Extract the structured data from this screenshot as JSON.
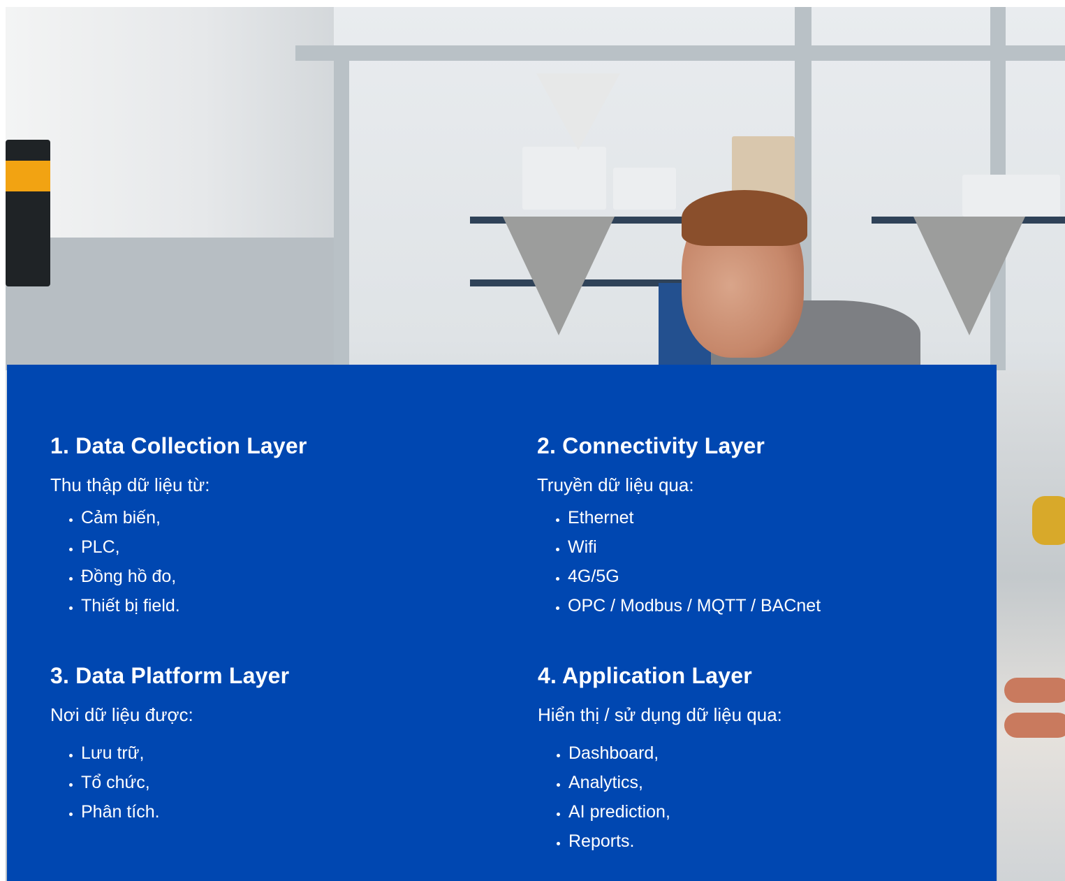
{
  "sections": [
    {
      "title": "1. Data Collection Layer",
      "intro": "Thu thập dữ liệu từ:",
      "items": [
        "Cảm biến,",
        "PLC,",
        "Đồng hồ đo,",
        "Thiết bị field."
      ]
    },
    {
      "title": "2. Connectivity Layer",
      "intro": "Truyền dữ liệu qua:",
      "items": [
        "Ethernet",
        "Wifi",
        "4G/5G",
        "OPC / Modbus / MQTT / BACnet"
      ]
    },
    {
      "title": "3. Data Platform Layer",
      "intro": "Nơi dữ liệu được:",
      "items": [
        "Lưu trữ,",
        "Tổ chức,",
        "Phân tích."
      ]
    },
    {
      "title": "4. Application Layer",
      "intro": "Hiển thị / sử dụng dữ liệu qua:",
      "items": [
        "Dashboard,",
        "Analytics,",
        "AI prediction,",
        "Reports."
      ]
    }
  ],
  "colors": {
    "panel_background": "#0047b1",
    "text": "#ffffff"
  }
}
